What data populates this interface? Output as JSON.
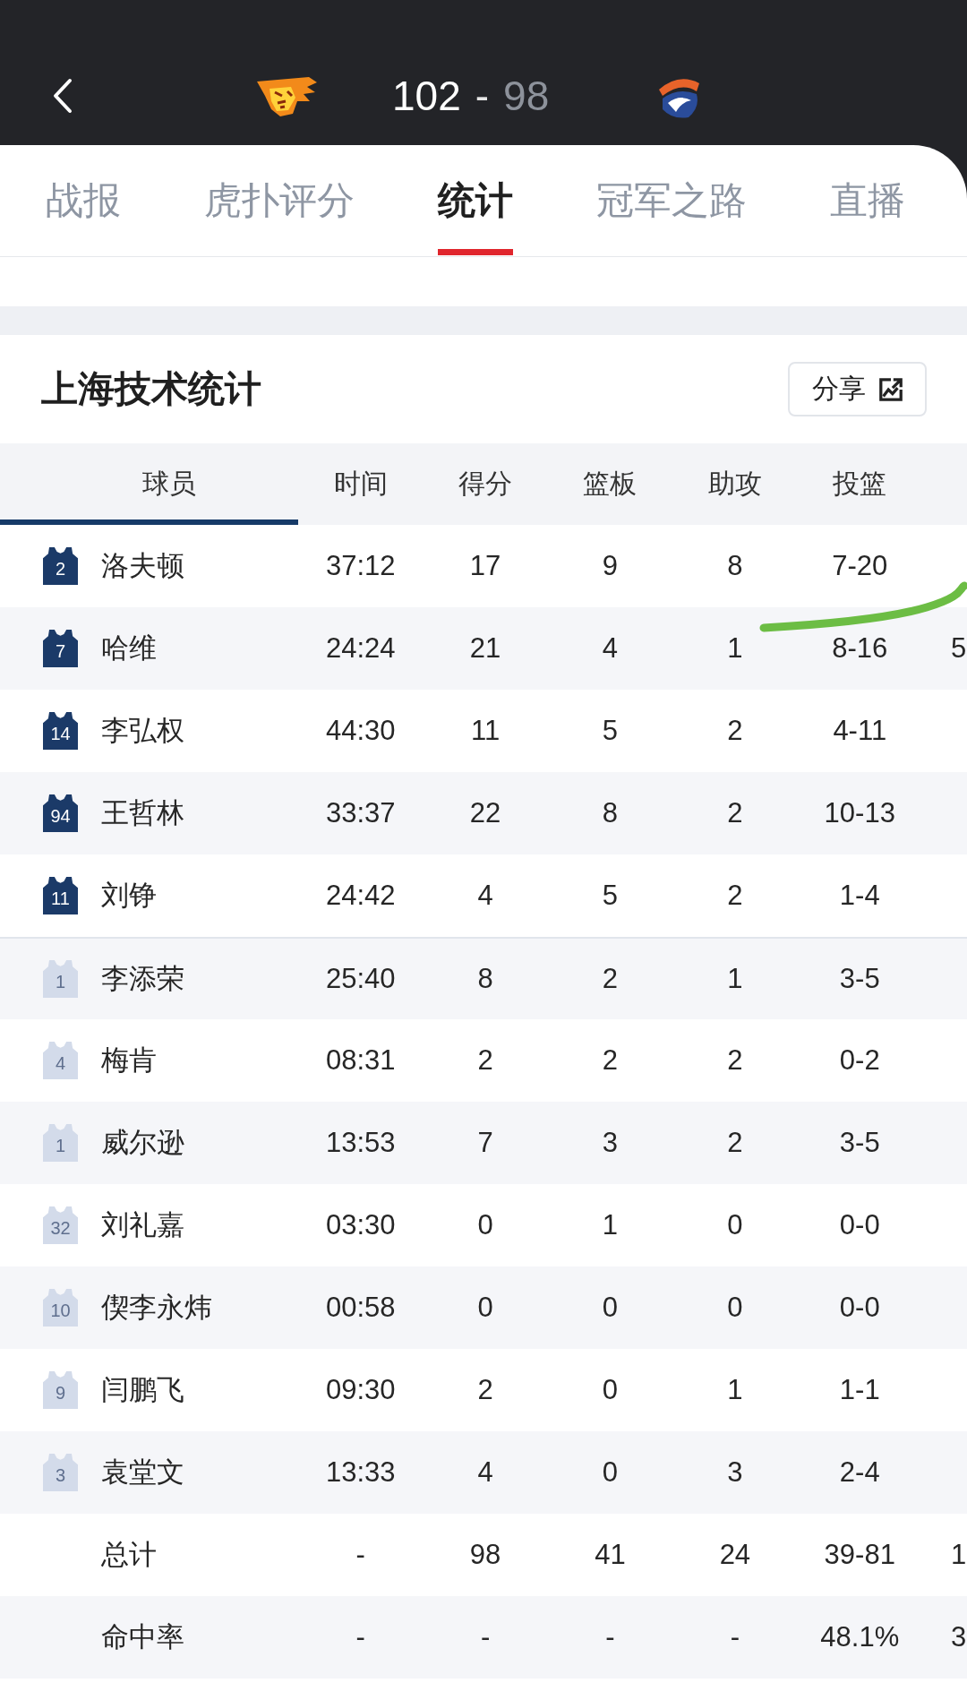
{
  "header": {
    "home_score": "102",
    "separator": "-",
    "away_score": "98"
  },
  "tabs": [
    {
      "label": "战报",
      "selected": false
    },
    {
      "label": "虎扑评分",
      "selected": false
    },
    {
      "label": "统计",
      "selected": true
    },
    {
      "label": "冠军之路",
      "selected": false
    },
    {
      "label": "直播",
      "selected": false
    }
  ],
  "stats": {
    "title": "上海技术统计",
    "share_label": "分享"
  },
  "table": {
    "columns": [
      {
        "label": "球员",
        "selected": true
      },
      {
        "label": "时间",
        "selected": false
      },
      {
        "label": "得分",
        "selected": false
      },
      {
        "label": "篮板",
        "selected": false
      },
      {
        "label": "助攻",
        "selected": false
      },
      {
        "label": "投篮",
        "selected": false
      }
    ],
    "players": [
      {
        "number": "2",
        "name": "洛夫顿",
        "starter": true,
        "values": [
          "37:12",
          "17",
          "9",
          "8",
          "7-20"
        ]
      },
      {
        "number": "7",
        "name": "哈维",
        "starter": true,
        "values": [
          "24:24",
          "21",
          "4",
          "1",
          "8-16"
        ],
        "column_7": "5"
      },
      {
        "number": "14",
        "name": "李弘权",
        "starter": true,
        "values": [
          "44:30",
          "11",
          "5",
          "2",
          "4-11"
        ]
      },
      {
        "number": "94",
        "name": "王哲林",
        "starter": true,
        "values": [
          "33:37",
          "22",
          "8",
          "2",
          "10-13"
        ]
      },
      {
        "number": "11",
        "name": "刘铮",
        "starter": true,
        "values": [
          "24:42",
          "4",
          "5",
          "2",
          "1-4"
        ]
      },
      {
        "number": "1",
        "name": "李添荣",
        "starter": false,
        "values": [
          "25:40",
          "8",
          "2",
          "1",
          "3-5"
        ]
      },
      {
        "number": "4",
        "name": "梅肯",
        "starter": false,
        "values": [
          "08:31",
          "2",
          "2",
          "2",
          "0-2"
        ]
      },
      {
        "number": "1",
        "name": "威尔逊",
        "starter": false,
        "values": [
          "13:53",
          "7",
          "3",
          "2",
          "3-5"
        ]
      },
      {
        "number": "32",
        "name": "刘礼嘉",
        "starter": false,
        "values": [
          "03:30",
          "0",
          "1",
          "0",
          "0-0"
        ]
      },
      {
        "number": "10",
        "name": "偰李永炜",
        "starter": false,
        "values": [
          "00:58",
          "0",
          "0",
          "0",
          "0-0"
        ]
      },
      {
        "number": "9",
        "name": "闫鹏飞",
        "starter": false,
        "values": [
          "09:30",
          "2",
          "0",
          "1",
          "1-1"
        ]
      },
      {
        "number": "3",
        "name": "袁堂文",
        "starter": false,
        "values": [
          "13:33",
          "4",
          "0",
          "3",
          "2-4"
        ]
      }
    ],
    "summary_rows": [
      {
        "label": "总计",
        "values": [
          "-",
          "98",
          "41",
          "24",
          "39-81"
        ],
        "column_7": "1"
      },
      {
        "label": "命中率",
        "values": [
          "-",
          "-",
          "-",
          "-",
          "48.1%"
        ],
        "column_7": "3"
      }
    ]
  },
  "pen_stroke": true
}
